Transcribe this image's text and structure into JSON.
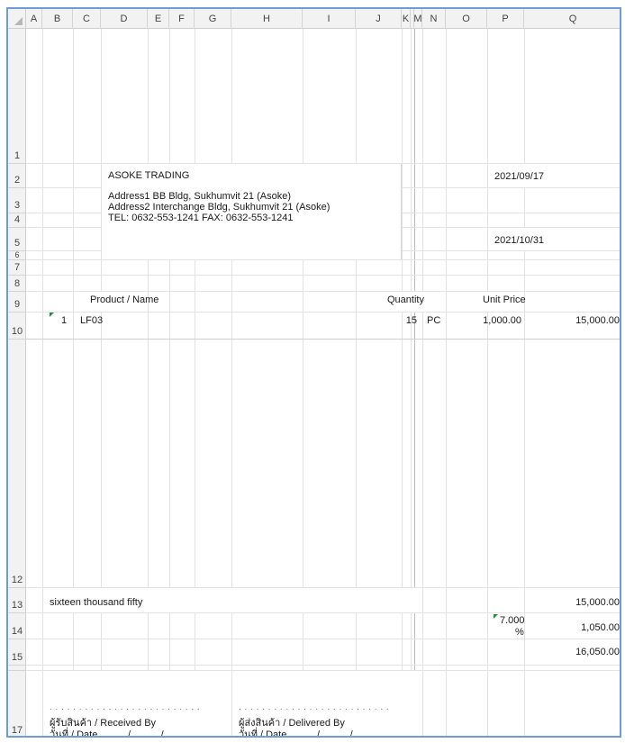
{
  "columns": [
    "A",
    "B",
    "C",
    "D",
    "E",
    "F",
    "G",
    "H",
    "I",
    "J",
    "K",
    "L",
    "M",
    "N",
    "O",
    "P",
    "Q"
  ],
  "rows": [
    "1",
    "2",
    "3",
    "4",
    "5",
    "6",
    "7",
    "8",
    "9",
    "10",
    "12",
    "13",
    "14",
    "15",
    "17"
  ],
  "company": {
    "name": "ASOKE TRADING",
    "address1": "Address1  BB Bldg, Sukhumvit 21 (Asoke)",
    "address2": "Address2 Interchange Bldg, Sukhumvit 21 (Asoke)",
    "tel_fax": "TEL:  0632-553-1241     FAX:  0632-553-1241"
  },
  "dates": {
    "doc_date": "2021/09/17",
    "due_date": "2021/10/31"
  },
  "table_headers": {
    "product": "Product / Name",
    "quantity": "Quantity",
    "unit_price": "Unit Price"
  },
  "line_item": {
    "no": "1",
    "code": "LF03",
    "qty": "15",
    "unit": "PC",
    "price": "1,000.00",
    "amount": "15,000.00"
  },
  "totals": {
    "amount_words": "sixteen thousand fifty",
    "subtotal": "15,000.00",
    "vat_rate": "7.000",
    "vat_pct": "%",
    "vat_amount": "1,050.00",
    "grand_total": "16,050.00"
  },
  "signatures": {
    "received_by": "ผู้รับสินค้า / Received By",
    "received_date": "วันที่ / Date . . . . . / . . . . . / . . . . .",
    "delivered_by": "ผู้ส่งสินค้า / Delivered By",
    "delivered_date": "วันที่ / Date . . . . . / . . . . . / . . . . .",
    "dots": ". . . . . . . . . . . . . . . . . . . . . . . . . ."
  }
}
